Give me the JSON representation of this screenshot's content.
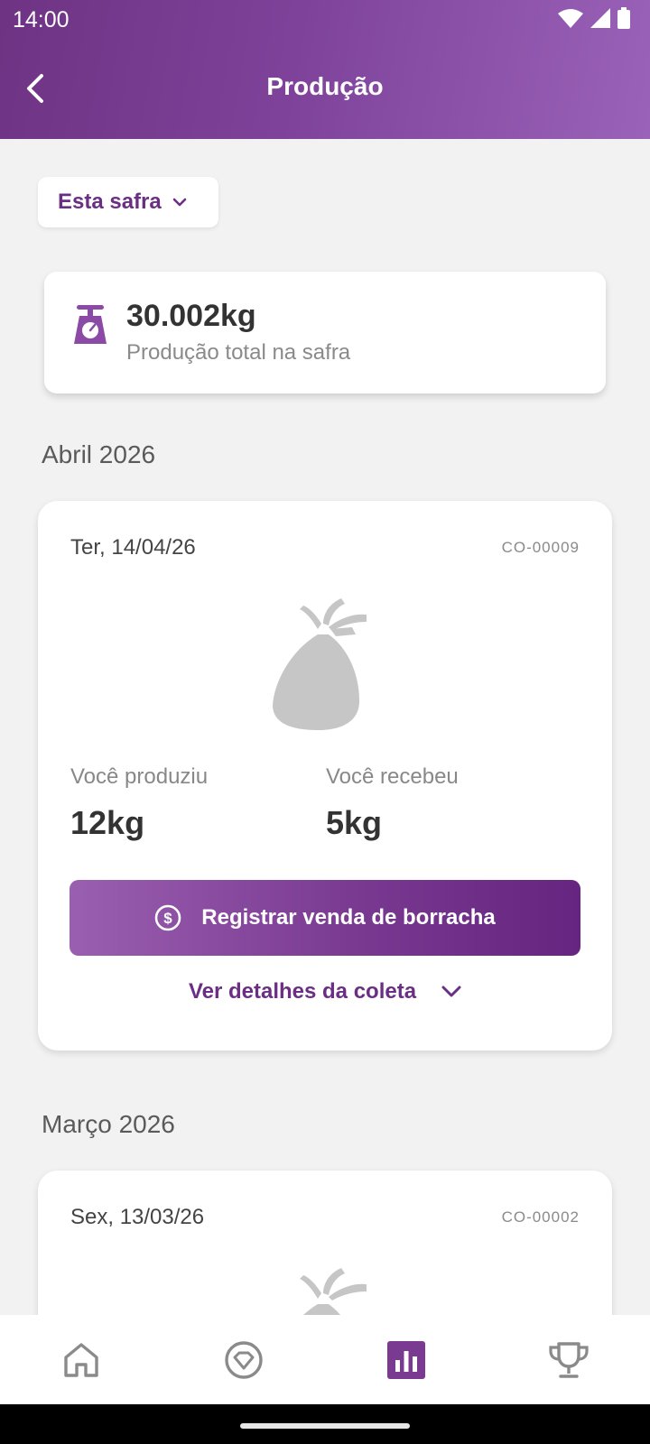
{
  "status_bar": {
    "time": "14:00"
  },
  "header": {
    "title": "Produção"
  },
  "filter": {
    "label": "Esta safra"
  },
  "summary": {
    "value": "30.002kg",
    "label": "Produção total na safra"
  },
  "sections": [
    {
      "month": "Abril 2026",
      "entry": {
        "date": "Ter, 14/04/26",
        "code": "CO-00009",
        "produced_label": "Você produziu",
        "produced_value": "12kg",
        "received_label": "Você recebeu",
        "received_value": "5kg",
        "sell_button": "Registrar venda de borracha",
        "details_link": "Ver detalhes da coleta"
      }
    },
    {
      "month": "Março 2026",
      "entry": {
        "date": "Sex, 13/03/26",
        "code": "CO-00002"
      }
    }
  ],
  "bottom_nav": {
    "items": [
      {
        "icon": "home-icon",
        "active": false
      },
      {
        "icon": "gem-icon",
        "active": false
      },
      {
        "icon": "bar-chart-icon",
        "active": true
      },
      {
        "icon": "trophy-icon",
        "active": false
      }
    ]
  },
  "colors": {
    "brand": "#7a3a92",
    "brand_dark": "#6a2f84",
    "icon_inactive": "#8a8a8a",
    "bag": "#c6c6c6"
  }
}
